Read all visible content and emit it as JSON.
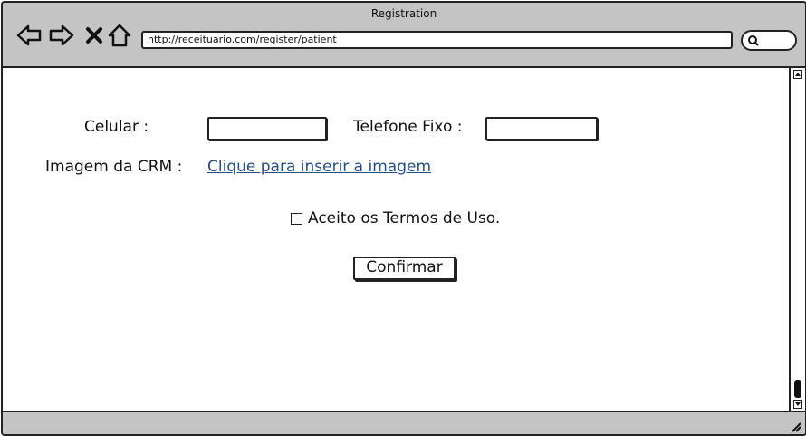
{
  "window": {
    "title": "Registration"
  },
  "browser": {
    "url": "http://receituario.com/register/patient",
    "icons": [
      "back-arrow-icon",
      "forward-arrow-icon",
      "close-x-icon",
      "home-icon",
      "search-icon"
    ]
  },
  "form": {
    "celular_label": "Celular :",
    "celular_value": "",
    "telefone_label": "Telefone Fixo :",
    "telefone_value": "",
    "crm_label": "Imagem da CRM :",
    "crm_link": "Clique para inserir a imagem",
    "terms_label": "Aceito os Termos de Uso.",
    "terms_checked": false,
    "confirm_label": "Confirmar"
  },
  "colors": {
    "chrome": "#c4c4c4",
    "link": "#1f4e8c",
    "border": "#222222"
  }
}
